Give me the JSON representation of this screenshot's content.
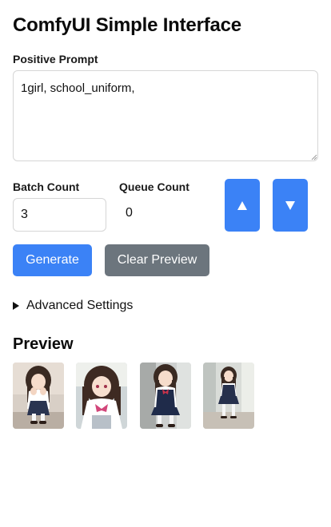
{
  "app": {
    "title": "ComfyUI Simple Interface"
  },
  "prompt": {
    "label": "Positive Prompt",
    "value": "1girl, school_uniform,"
  },
  "batch": {
    "label": "Batch Count",
    "value": "3"
  },
  "queue": {
    "label": "Queue Count",
    "value": "0"
  },
  "controls": {
    "up_icon": "triangle-up-icon",
    "down_icon": "triangle-down-icon",
    "up_glyph": "▲",
    "down_glyph": "▼"
  },
  "actions": {
    "generate_label": "Generate",
    "clear_label": "Clear Preview"
  },
  "advanced": {
    "label": "Advanced Settings",
    "expanded": false
  },
  "preview": {
    "title": "Preview",
    "image_count": 4
  },
  "colors": {
    "primary": "#3b82f6",
    "secondary": "#6c757d"
  }
}
